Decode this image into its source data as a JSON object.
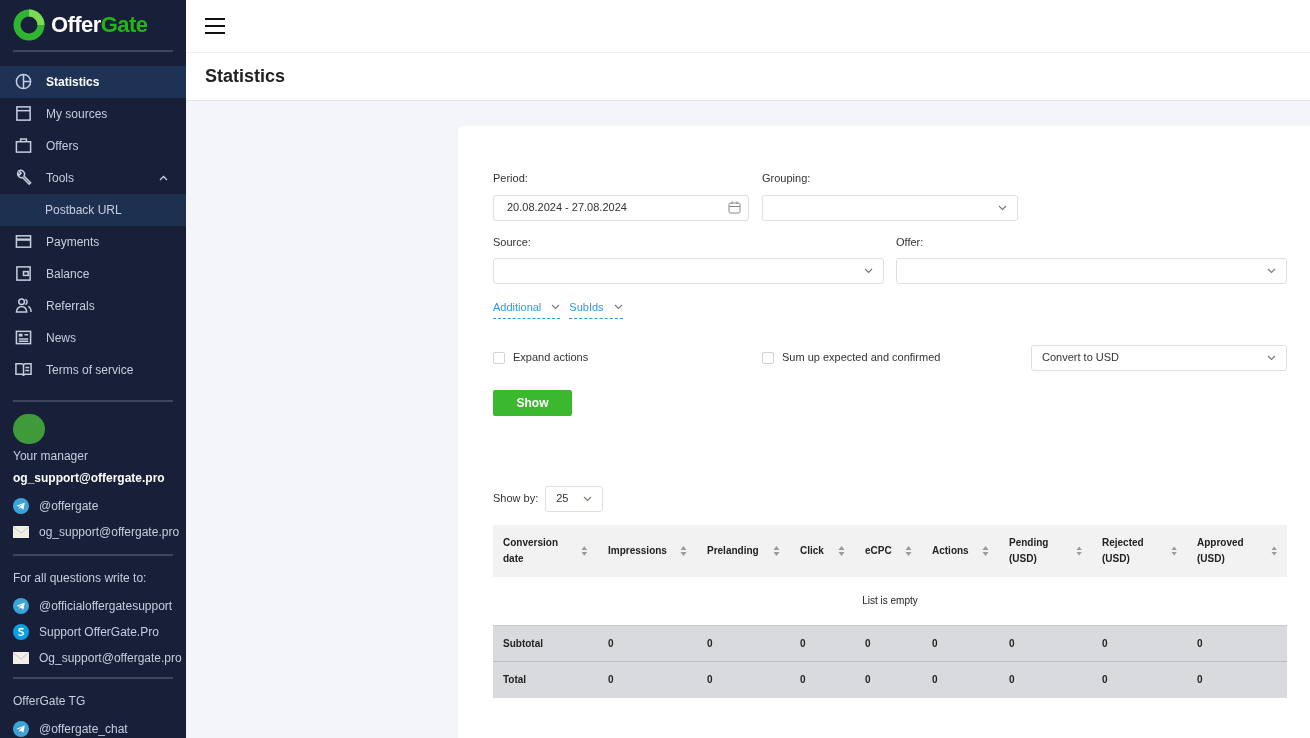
{
  "logo": {
    "part1": "Offer",
    "part2": "Gate"
  },
  "nav": [
    {
      "label": "Statistics",
      "kind": "pie",
      "selected": true
    },
    {
      "label": "My sources",
      "kind": "window",
      "selected": false
    },
    {
      "label": "Offers",
      "kind": "bag",
      "selected": false
    },
    {
      "label": "Tools",
      "kind": "wrench",
      "selected": false,
      "expanded": true,
      "children": [
        {
          "label": "Postback URL",
          "selected": false
        }
      ]
    },
    {
      "label": "Payments",
      "kind": "card",
      "selected": false
    },
    {
      "label": "Balance",
      "kind": "wallet",
      "selected": false
    },
    {
      "label": "Referrals",
      "kind": "people",
      "selected": false
    },
    {
      "label": "News",
      "kind": "news",
      "selected": false
    },
    {
      "label": "Terms of service",
      "kind": "book",
      "selected": false
    }
  ],
  "manager": {
    "label": "Your manager",
    "email": "og_support@offergate.pro",
    "contacts": [
      {
        "kind": "telegram",
        "text": "@offergate"
      },
      {
        "kind": "mail",
        "text": "og_support@offergate.pro"
      }
    ]
  },
  "questions": {
    "label": "For all questions write to:",
    "contacts": [
      {
        "kind": "telegram",
        "text": "@officialoffergatesupport"
      },
      {
        "kind": "skype",
        "text": "Support OfferGate.Pro"
      },
      {
        "kind": "mail",
        "text": "Og_support@offergate.pro"
      }
    ]
  },
  "tg": {
    "label": "OfferGate TG",
    "contacts": [
      {
        "kind": "telegram",
        "text": "@offergate_chat"
      }
    ]
  },
  "page_title": "Statistics",
  "filters": {
    "period_label": "Period:",
    "period_value": "20.08.2024 - 27.08.2024",
    "grouping_label": "Grouping:",
    "source_label": "Source:",
    "offer_label": "Offer:",
    "toggles": [
      "Additional",
      "SubIds"
    ],
    "checks": [
      {
        "label": "Expand actions",
        "checked": false
      },
      {
        "label": "Sum up expected and confirmed",
        "checked": false
      }
    ],
    "currency": "Convert to USD",
    "show_button": "Show"
  },
  "show_by": {
    "label": "Show by:",
    "value": "25"
  },
  "table": {
    "columns": [
      "Conversion date",
      "Impressions",
      "Prelanding",
      "Click",
      "eCPC",
      "Actions",
      "Pending (USD)",
      "Rejected (USD)",
      "Approved (USD)"
    ],
    "empty": "List is empty",
    "rows": [
      [
        "Subtotal",
        "0",
        "0",
        "0",
        "0",
        "0",
        "0",
        "0",
        "0"
      ],
      [
        "Total",
        "0",
        "0",
        "0",
        "0",
        "0",
        "0",
        "0",
        "0"
      ]
    ]
  }
}
